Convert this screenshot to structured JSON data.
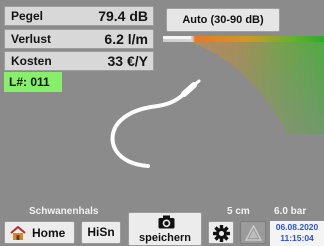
{
  "readouts": [
    {
      "label": "Pegel",
      "value": "79.4 dB"
    },
    {
      "label": "Verlust",
      "value": "6.2 l/m"
    },
    {
      "label": "Kosten",
      "value": "33 €/Y"
    }
  ],
  "l_number": "L#: 011",
  "range_button": "Auto (30-90 dB)",
  "bottom_labels": {
    "probe": "Schwanenhals",
    "distance": "5 cm",
    "pressure": "6.0 bar"
  },
  "buttons": {
    "home": "Home",
    "hisn": "HiSn",
    "save": "speichern"
  },
  "datetime": {
    "date": "06.08.2020",
    "time": "11:15:04"
  },
  "icons": {
    "home": "house-icon",
    "camera": "camera-icon",
    "settings": "gear-icon",
    "alert": "warning-triangle-icon"
  },
  "colors": {
    "background": "#8b8b8b",
    "lnum_bg": "#87f06b",
    "date_text": "#2f52d0",
    "spectrum_low": "#2eaa2e",
    "spectrum_high": "#ee7722"
  }
}
